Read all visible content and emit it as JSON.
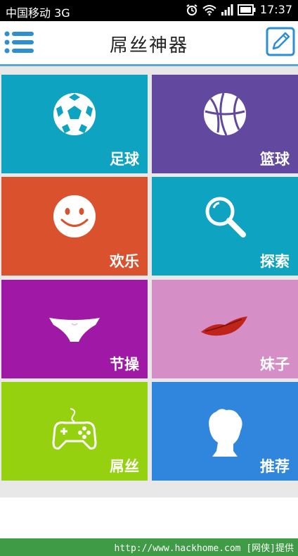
{
  "status_bar": {
    "carrier": "中国移动 3G",
    "time": "17:37",
    "icons": [
      "alarm-icon",
      "wifi-icon",
      "signal-icon",
      "battery-icon"
    ]
  },
  "app_bar": {
    "title": "屌丝神器",
    "menu_icon": "menu-icon",
    "edit_icon": "edit-icon"
  },
  "tiles": [
    {
      "label": "足球",
      "icon": "soccer-ball-icon",
      "color": "#0ea3c0"
    },
    {
      "label": "篮球",
      "icon": "basketball-icon",
      "color": "#62489e"
    },
    {
      "label": "欢乐",
      "icon": "smiley-icon",
      "color": "#d9522d"
    },
    {
      "label": "探索",
      "icon": "magnifier-icon",
      "color": "#0ea3c0"
    },
    {
      "label": "节操",
      "icon": "underwear-icon",
      "color": "#a018a6"
    },
    {
      "label": "妹子",
      "icon": "lips-icon",
      "color": "#d58fc6"
    },
    {
      "label": "屌丝",
      "icon": "gamepad-icon",
      "color": "#96d10f"
    },
    {
      "label": "推荐",
      "icon": "person-head-icon",
      "color": "#2f86dc"
    }
  ],
  "footer": {
    "credit": "http://www.hackhome.com [网侠]提供"
  }
}
